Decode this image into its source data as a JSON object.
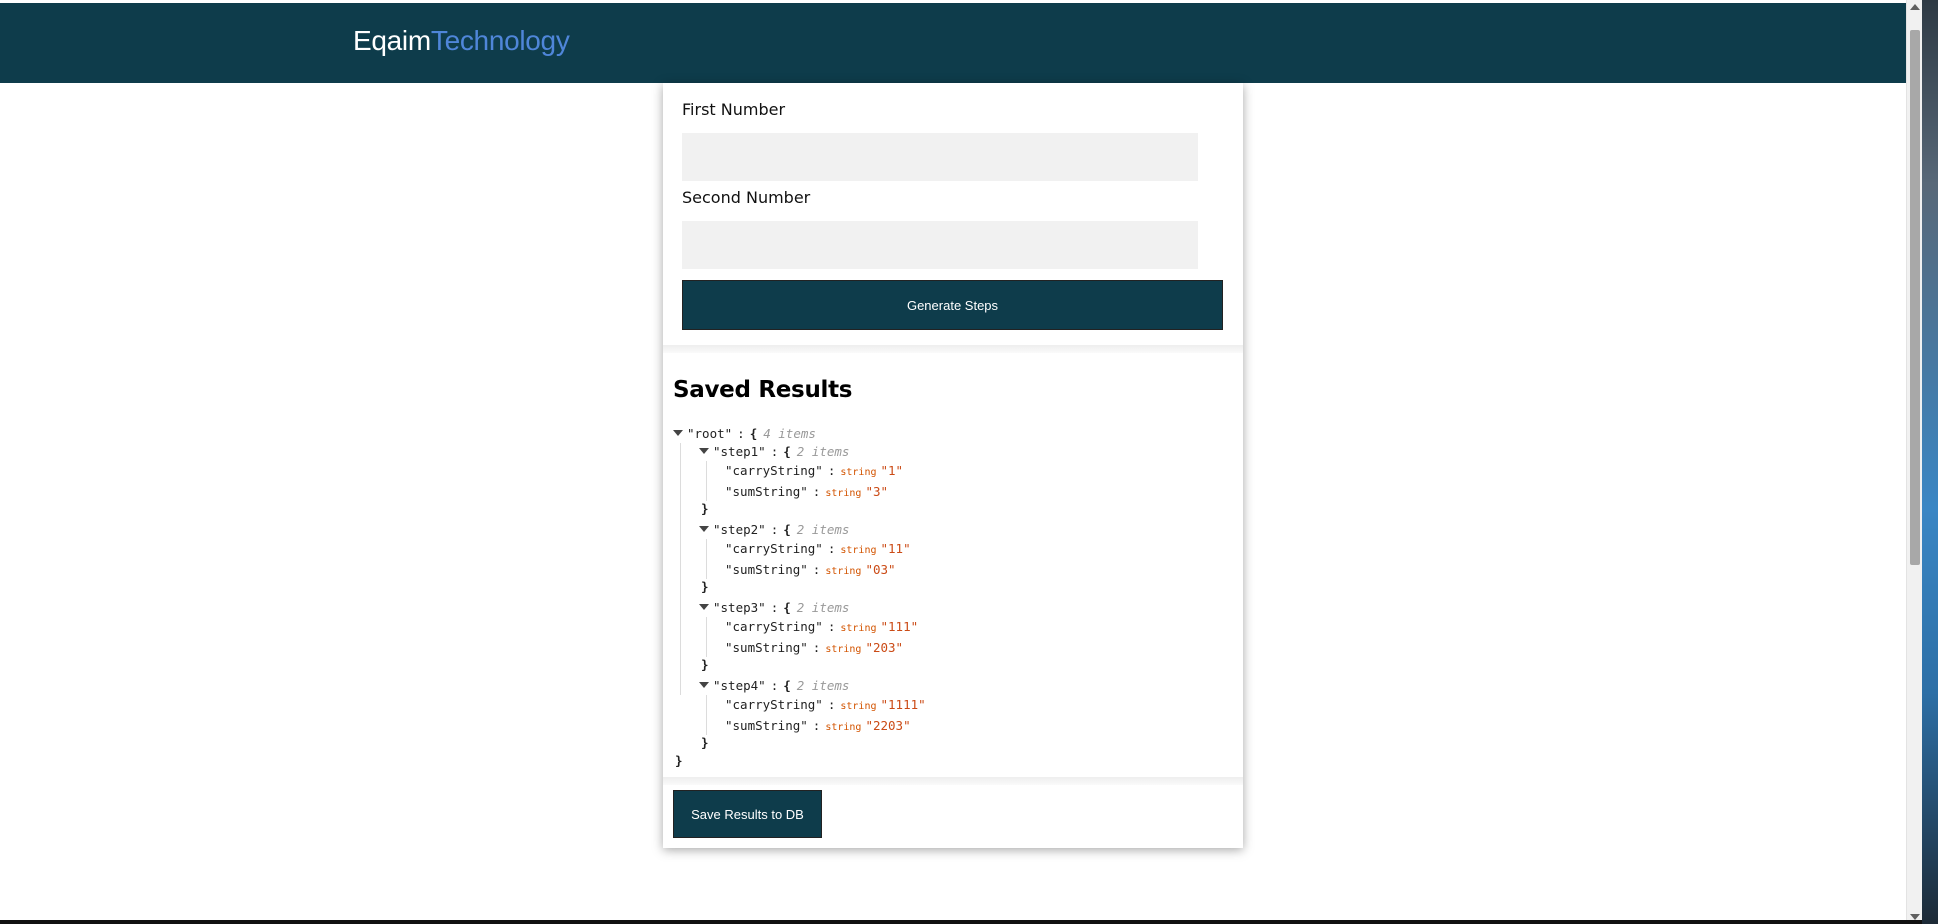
{
  "header": {
    "brand_part1": "Eqaim",
    "brand_part2": "Technology"
  },
  "form": {
    "first_label": "First Number",
    "first_value": "",
    "second_label": "Second Number",
    "second_value": "",
    "generate_label": "Generate Steps"
  },
  "results": {
    "title": "Saved Results",
    "save_label": "Save Results to DB"
  },
  "tree": {
    "root_key": "\"root\"",
    "root_count": "4 items",
    "steps": [
      {
        "key": "\"step1\"",
        "count": "2 items",
        "carry_key": "\"carryString\"",
        "carry_type": "string",
        "carry_val": "\"1\"",
        "sum_key": "\"sumString\"",
        "sum_type": "string",
        "sum_val": "\"3\""
      },
      {
        "key": "\"step2\"",
        "count": "2 items",
        "carry_key": "\"carryString\"",
        "carry_type": "string",
        "carry_val": "\"11\"",
        "sum_key": "\"sumString\"",
        "sum_type": "string",
        "sum_val": "\"03\""
      },
      {
        "key": "\"step3\"",
        "count": "2 items",
        "carry_key": "\"carryString\"",
        "carry_type": "string",
        "carry_val": "\"111\"",
        "sum_key": "\"sumString\"",
        "sum_type": "string",
        "sum_val": "\"203\""
      },
      {
        "key": "\"step4\"",
        "count": "2 items",
        "carry_key": "\"carryString\"",
        "carry_type": "string",
        "carry_val": "\"1111\"",
        "sum_key": "\"sumString\"",
        "sum_type": "string",
        "sum_val": "\"2203\""
      }
    ],
    "colon": ":",
    "open_brace": "{",
    "close_brace": "}"
  },
  "colors": {
    "navbar": "#0e3c4b",
    "brand_accent": "#4f86d9",
    "button": "#0e3c4b",
    "json_value": "#cb4b16"
  }
}
